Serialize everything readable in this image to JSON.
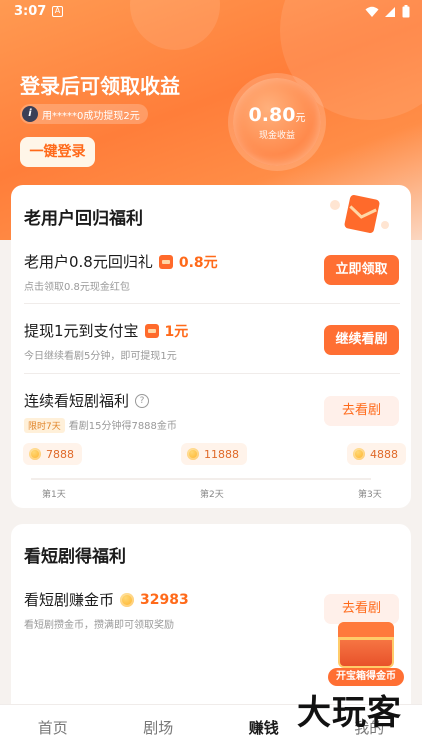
{
  "status_bar": {
    "time": "3:07"
  },
  "hero": {
    "title": "登录后可领取收益",
    "withdraw_tip": "用*****0成功提现2元",
    "login_button": "一键登录",
    "coin_amount": "0.80",
    "coin_unit": "元",
    "coin_label": "现金收益"
  },
  "card_return": {
    "title": "老用户回归福利",
    "rows": [
      {
        "title": "老用户0.8元回归礼",
        "amount": "0.8元",
        "subtitle": "点击领取0.8元现金红包",
        "button": "立即领取"
      },
      {
        "title": "提现1元到支付宝",
        "amount": "1元",
        "subtitle": "今日继续看剧5分钟，即可提现1元",
        "button": "继续看剧"
      }
    ],
    "streak": {
      "title": "连续看短剧福利",
      "limit_tag": "限时7天",
      "subtitle": "看剧15分钟得7888金币",
      "button": "去看剧",
      "stages": [
        {
          "coins": "7888",
          "label": "第1天"
        },
        {
          "coins": "11888",
          "label": "第2天"
        },
        {
          "coins": "4888",
          "label": "第3天"
        }
      ]
    }
  },
  "card_watch": {
    "title": "看短剧得福利",
    "row": {
      "title": "看短剧赚金币",
      "coins": "32983",
      "subtitle": "看短剧攒金币，攒满即可领取奖励",
      "button": "去看剧"
    }
  },
  "treasure_chest": {
    "label": "开宝箱得金币"
  },
  "tab_bar": {
    "tabs": [
      {
        "label": "首页",
        "active": false
      },
      {
        "label": "剧场",
        "active": false
      },
      {
        "label": "赚钱",
        "active": true
      },
      {
        "label": "我的",
        "active": false
      }
    ]
  },
  "watermark": "大玩客",
  "colors": {
    "accent": "#ff6f33",
    "hero_orange": "#ff7e3a",
    "amount_orange": "#ff6a1a"
  }
}
